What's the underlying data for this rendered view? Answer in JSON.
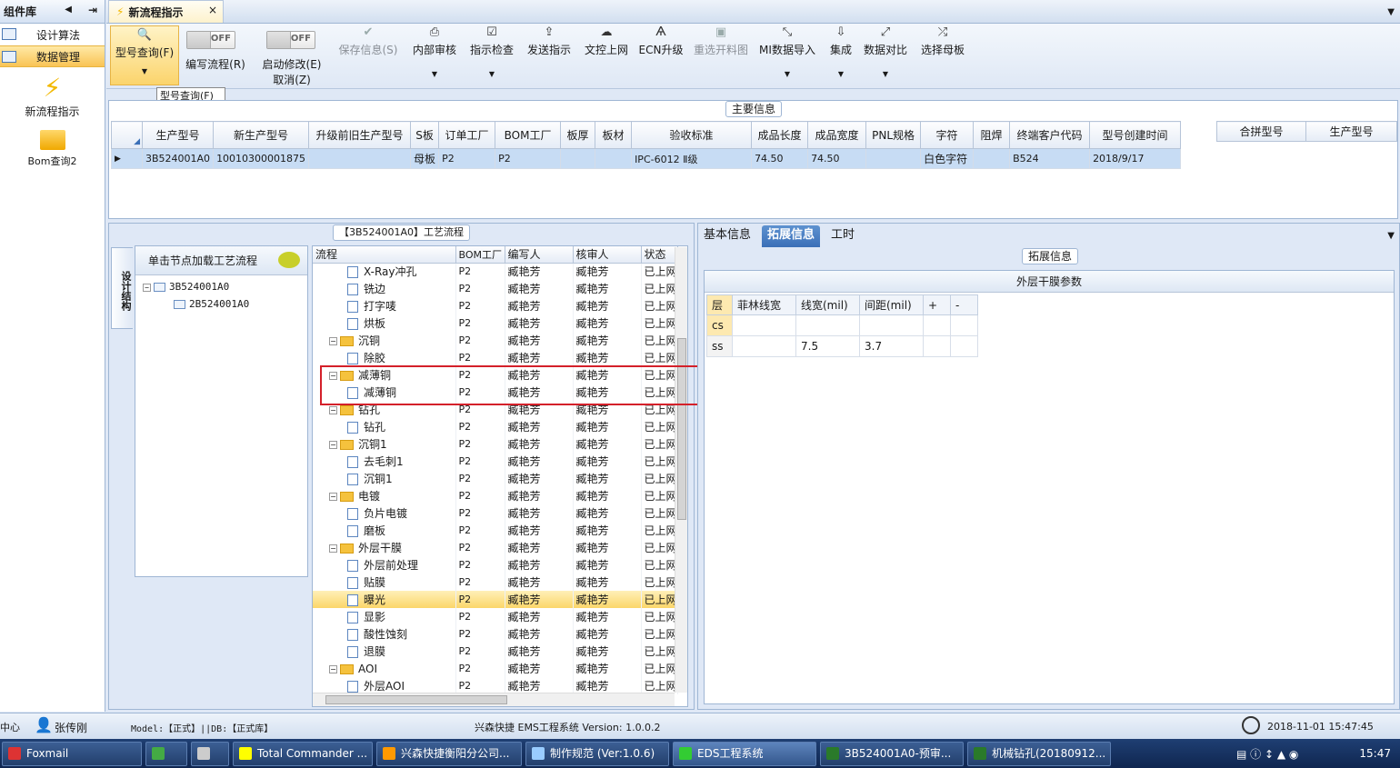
{
  "left_panel": {
    "title": "组件库",
    "items": [
      {
        "label": "设计算法"
      },
      {
        "label": "数据管理"
      }
    ],
    "big_items": [
      {
        "label": "新流程指示"
      },
      {
        "label": "Bom查询2"
      }
    ]
  },
  "doc_tab": {
    "title": "新流程指示",
    "close": "×"
  },
  "toolbar": {
    "query": "型号查询(F)",
    "tooltip": "型号查询(F)",
    "toggle_off": "OFF",
    "write_flow": "编写流程(R)",
    "start_edit": "启动修改(E)",
    "cancel": "取消(Z)",
    "save": "保存信息(S)",
    "internal_review": "内部审核",
    "check": "指示检查",
    "send": "发送指示",
    "upload": "文控上网",
    "ecn": "ECN升级",
    "regen": "重选开料图",
    "mi_import": "MI数据导入",
    "integrate": "集成",
    "compare": "数据对比",
    "select_board": "选择母板"
  },
  "main_info": {
    "label": "主要信息",
    "columns": [
      "生产型号",
      "新生产型号",
      "升级前旧生产型号",
      "S板",
      "订单工厂",
      "BOM工厂",
      "板厚",
      "板材",
      "验收标准",
      "成品长度",
      "成品宽度",
      "PNL规格",
      "字符",
      "阻焊",
      "终端客户代码",
      "型号创建时间"
    ],
    "rows": [
      [
        "3B524001A0",
        "10010300001875",
        "",
        "母板",
        "P2",
        "P2",
        "",
        "",
        "IPC-6012 Ⅱ级",
        "74.50",
        "74.50",
        "",
        "白色字符",
        "",
        "B524",
        "2018/9/17"
      ]
    ],
    "merge_columns": [
      "合拼型号",
      "生产型号"
    ]
  },
  "flow": {
    "label": "【3B524001A0】工艺流程",
    "side_tab": "设计结构",
    "tree_head": "单击节点加载工艺流程",
    "tree_nodes": [
      "3B524001A0",
      "2B524001A0"
    ],
    "columns": [
      "流程",
      "BOM工厂",
      "编写人",
      "核审人",
      "状态"
    ],
    "rows": [
      {
        "name": "X-Ray冲孔",
        "type": "file",
        "bom": "P2",
        "writer": "臧艳芳",
        "checker": "臧艳芳",
        "status": "已上网"
      },
      {
        "name": "铣边",
        "type": "file",
        "bom": "P2",
        "writer": "臧艳芳",
        "checker": "臧艳芳",
        "status": "已上网"
      },
      {
        "name": "打字唛",
        "type": "file",
        "bom": "P2",
        "writer": "臧艳芳",
        "checker": "臧艳芳",
        "status": "已上网"
      },
      {
        "name": "烘板",
        "type": "file",
        "bom": "P2",
        "writer": "臧艳芳",
        "checker": "臧艳芳",
        "status": "已上网"
      },
      {
        "name": "沉铜",
        "type": "folder",
        "bom": "P2",
        "writer": "臧艳芳",
        "checker": "臧艳芳",
        "status": "已上网"
      },
      {
        "name": "除胶",
        "type": "file",
        "bom": "P2",
        "writer": "臧艳芳",
        "checker": "臧艳芳",
        "status": "已上网"
      },
      {
        "name": "减薄铜",
        "type": "folder",
        "bom": "P2",
        "writer": "臧艳芳",
        "checker": "臧艳芳",
        "status": "已上网"
      },
      {
        "name": "减薄铜",
        "type": "file",
        "bom": "P2",
        "writer": "臧艳芳",
        "checker": "臧艳芳",
        "status": "已上网"
      },
      {
        "name": "钻孔",
        "type": "folder",
        "bom": "P2",
        "writer": "臧艳芳",
        "checker": "臧艳芳",
        "status": "已上网"
      },
      {
        "name": "钻孔",
        "type": "file",
        "bom": "P2",
        "writer": "臧艳芳",
        "checker": "臧艳芳",
        "status": "已上网"
      },
      {
        "name": "沉铜1",
        "type": "folder",
        "bom": "P2",
        "writer": "臧艳芳",
        "checker": "臧艳芳",
        "status": "已上网"
      },
      {
        "name": "去毛刺1",
        "type": "file",
        "bom": "P2",
        "writer": "臧艳芳",
        "checker": "臧艳芳",
        "status": "已上网"
      },
      {
        "name": "沉铜1",
        "type": "file",
        "bom": "P2",
        "writer": "臧艳芳",
        "checker": "臧艳芳",
        "status": "已上网"
      },
      {
        "name": "电镀",
        "type": "folder",
        "bom": "P2",
        "writer": "臧艳芳",
        "checker": "臧艳芳",
        "status": "已上网"
      },
      {
        "name": "负片电镀",
        "type": "file",
        "bom": "P2",
        "writer": "臧艳芳",
        "checker": "臧艳芳",
        "status": "已上网"
      },
      {
        "name": "磨板",
        "type": "file",
        "bom": "P2",
        "writer": "臧艳芳",
        "checker": "臧艳芳",
        "status": "已上网"
      },
      {
        "name": "外层干膜",
        "type": "folder",
        "bom": "P2",
        "writer": "臧艳芳",
        "checker": "臧艳芳",
        "status": "已上网"
      },
      {
        "name": "外层前处理",
        "type": "file",
        "bom": "P2",
        "writer": "臧艳芳",
        "checker": "臧艳芳",
        "status": "已上网"
      },
      {
        "name": "贴膜",
        "type": "file",
        "bom": "P2",
        "writer": "臧艳芳",
        "checker": "臧艳芳",
        "status": "已上网"
      },
      {
        "name": "曝光",
        "type": "file",
        "bom": "P2",
        "writer": "臧艳芳",
        "checker": "臧艳芳",
        "status": "已上网",
        "hl": true
      },
      {
        "name": "显影",
        "type": "file",
        "bom": "P2",
        "writer": "臧艳芳",
        "checker": "臧艳芳",
        "status": "已上网"
      },
      {
        "name": "酸性蚀刻",
        "type": "file",
        "bom": "P2",
        "writer": "臧艳芳",
        "checker": "臧艳芳",
        "status": "已上网"
      },
      {
        "name": "退膜",
        "type": "file",
        "bom": "P2",
        "writer": "臧艳芳",
        "checker": "臧艳芳",
        "status": "已上网"
      },
      {
        "name": "AOI",
        "type": "folder",
        "bom": "P2",
        "writer": "臧艳芳",
        "checker": "臧艳芳",
        "status": "已上网"
      },
      {
        "name": "外层AOI",
        "type": "file",
        "bom": "P2",
        "writer": "臧艳芳",
        "checker": "臧艳芳",
        "status": "已上网"
      }
    ]
  },
  "right": {
    "tabs": [
      "基本信息",
      "拓展信息",
      "工时"
    ],
    "ext_label": "拓展信息",
    "ext_title": "外层干膜参数",
    "ext_columns": [
      "层",
      "菲林线宽",
      "线宽(mil)",
      "间距(mil)",
      "+",
      "-"
    ],
    "ext_rows": [
      [
        "cs",
        "",
        "",
        "",
        "",
        ""
      ],
      [
        "ss",
        "",
        "7.5",
        "3.7",
        "",
        ""
      ]
    ]
  },
  "status": {
    "left": "中心",
    "user": "张传刚",
    "model": "Model:【正式】||DB:【正式库】",
    "center": "兴森快捷 EMS工程系统 Version: 1.0.0.2",
    "datetime": "2018-11-01 15:47:45"
  },
  "taskbar": {
    "items": [
      "Foxmail",
      "",
      "",
      "Total Commander ...",
      "兴森快捷衡阳分公司...",
      "制作规范 (Ver:1.0.6)",
      "EDS工程系统",
      "3B524001A0-预审...",
      "机械钻孔(20180912..."
    ],
    "time": "15:47"
  }
}
